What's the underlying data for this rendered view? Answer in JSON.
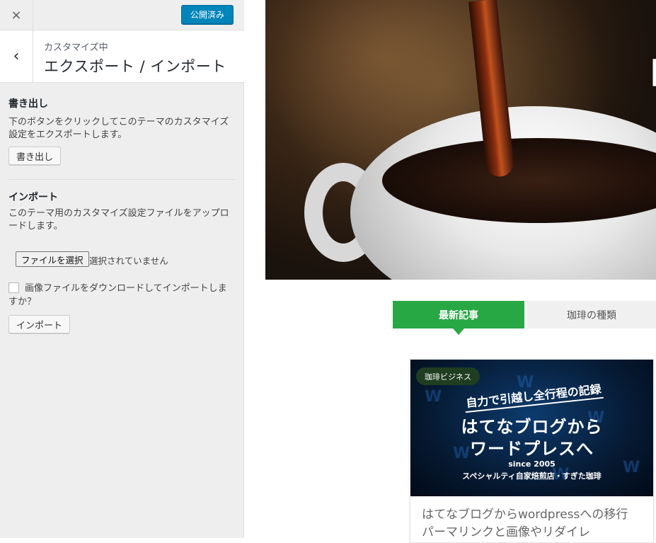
{
  "topbar": {
    "close_icon": "×",
    "publish_label": "公開済み"
  },
  "section_header": {
    "back_icon": "‹",
    "subtitle": "カスタマイズ中",
    "title": "エクスポート / インポート"
  },
  "export": {
    "heading": "書き出し",
    "description": "下のボタンをクリックしてこのテーマのカスタマイズ設定をエクスポートします。",
    "button_label": "書き出し"
  },
  "import": {
    "heading": "インポート",
    "description": "このテーマ用のカスタマイズ設定ファイルをアップロードします。",
    "file_button_label": "ファイルを選択",
    "file_status": "選択されていません",
    "checkbox_label": "画像ファイルをダウンロードしてインポートしますか？",
    "checkbox_checked": false,
    "button_label": "インポート"
  },
  "preview": {
    "hero_text": "「",
    "tabs": [
      {
        "label": "最新記事",
        "active": true
      },
      {
        "label": "珈琲の種類",
        "active": false
      }
    ],
    "card": {
      "badge": "珈琲ビジネス",
      "image_subtitle": "自力で引越し全行程の記録",
      "image_line1": "はてなブログから",
      "image_line2": "ワードプレスへ",
      "image_since": "since 2005",
      "image_shop": "スペシャルティ自家焙煎店・すぎた珈琲",
      "title": "はてなブログからwordpressへの移行　パーマリンクと画像やリダイレ"
    }
  },
  "colors": {
    "publish_button": "#0085ba",
    "active_tab": "#28a745",
    "sidebar_bg": "#eeeeee"
  }
}
